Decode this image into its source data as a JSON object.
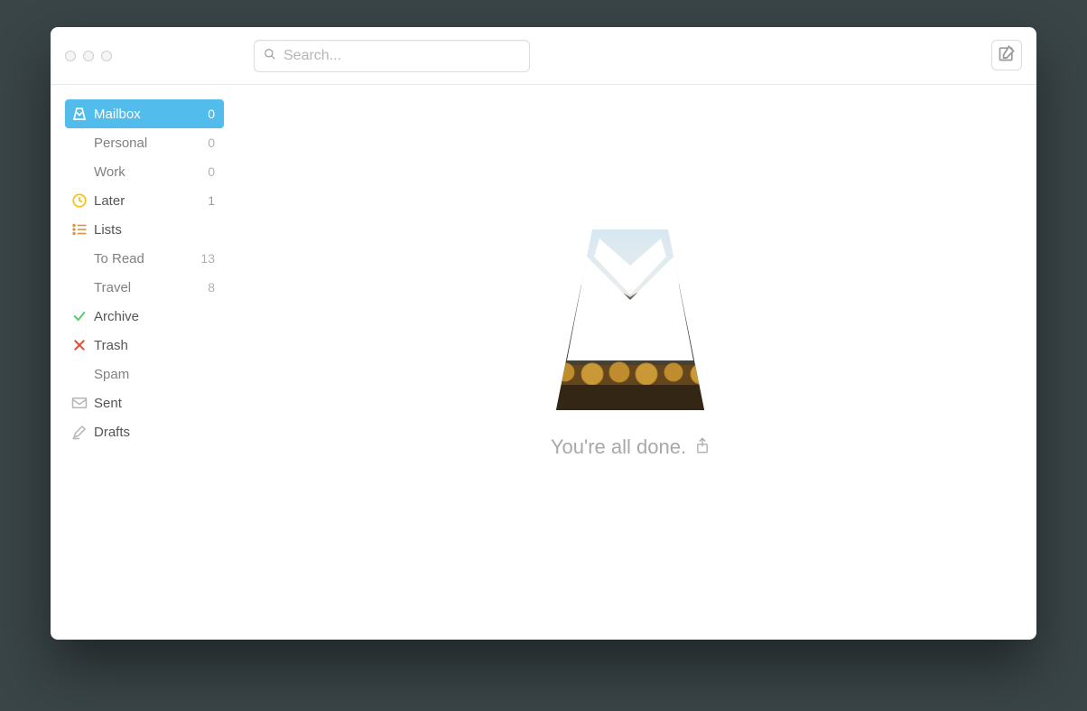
{
  "toolbar": {
    "search_placeholder": "Search..."
  },
  "sidebar": {
    "items": [
      {
        "label": "Mailbox",
        "count": "0",
        "icon": "mailbox",
        "active": true,
        "indent": false
      },
      {
        "label": "Personal",
        "count": "0",
        "icon": "",
        "active": false,
        "indent": true
      },
      {
        "label": "Work",
        "count": "0",
        "icon": "",
        "active": false,
        "indent": true
      },
      {
        "label": "Later",
        "count": "1",
        "icon": "later",
        "active": false,
        "indent": false
      },
      {
        "label": "Lists",
        "count": "",
        "icon": "lists",
        "active": false,
        "indent": false
      },
      {
        "label": "To Read",
        "count": "13",
        "icon": "",
        "active": false,
        "indent": true
      },
      {
        "label": "Travel",
        "count": "8",
        "icon": "",
        "active": false,
        "indent": true
      },
      {
        "label": "Archive",
        "count": "",
        "icon": "archive",
        "active": false,
        "indent": false
      },
      {
        "label": "Trash",
        "count": "",
        "icon": "trash",
        "active": false,
        "indent": false
      },
      {
        "label": "Spam",
        "count": "",
        "icon": "",
        "active": false,
        "indent": true
      },
      {
        "label": "Sent",
        "count": "",
        "icon": "sent",
        "active": false,
        "indent": false
      },
      {
        "label": "Drafts",
        "count": "",
        "icon": "drafts",
        "active": false,
        "indent": false
      }
    ]
  },
  "main": {
    "done_text": "You're all done."
  },
  "colors": {
    "accent_blue": "#52bdec",
    "later_yellow": "#f8c11c",
    "lists_orange": "#d9974a",
    "archive_green": "#5fc96e",
    "trash_red": "#e14b2f",
    "muted_gray": "#a8a8a8"
  }
}
